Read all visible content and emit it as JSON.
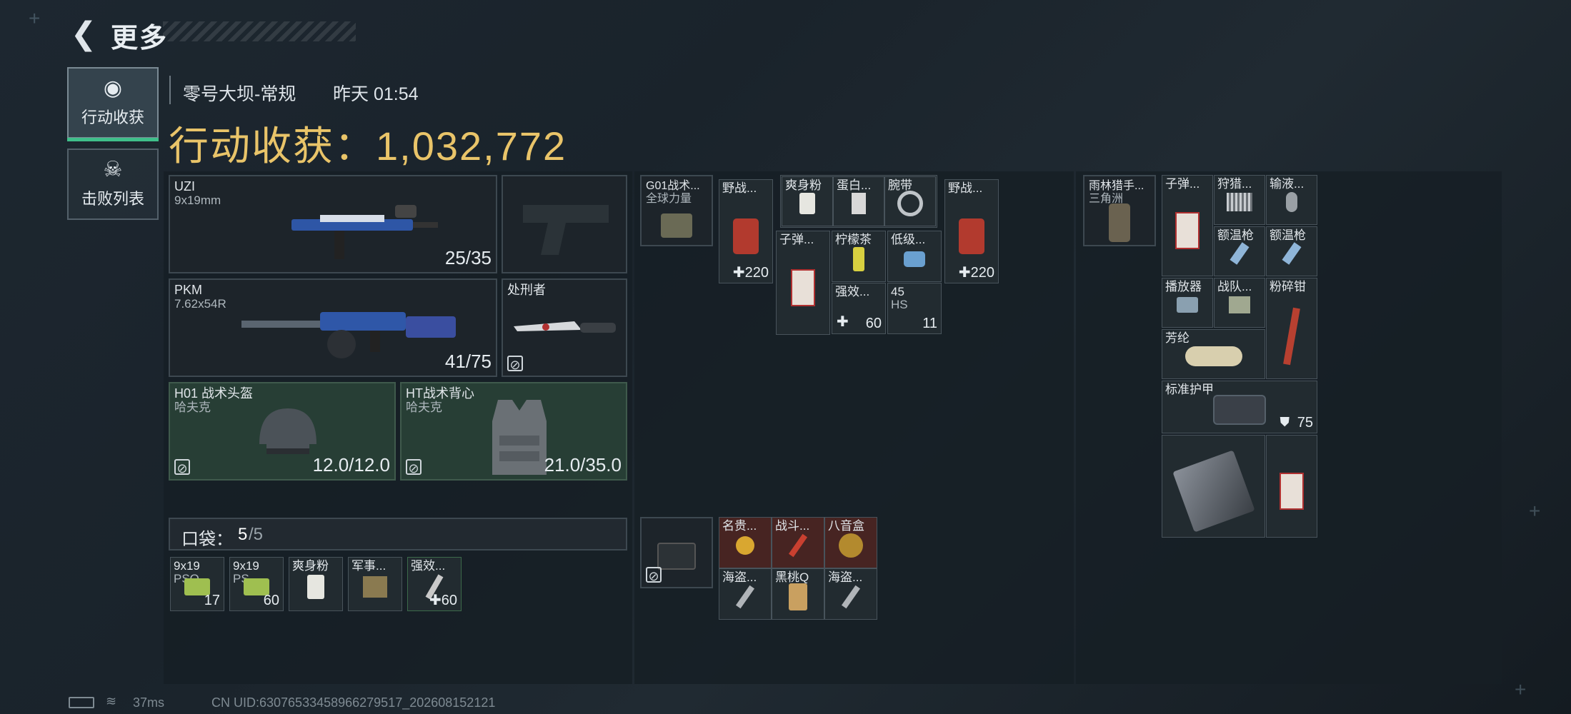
{
  "header": {
    "title": "更多"
  },
  "side_tabs": [
    {
      "label": "行动收获",
      "icon": "loot-coin-icon",
      "active": true
    },
    {
      "label": "击败列表",
      "icon": "skull-icon",
      "active": false
    }
  ],
  "raid": {
    "map": "零号大坝-常规",
    "time": "昨天 01:54"
  },
  "loot_title": "行动收获：1,032,772",
  "loadout": {
    "primary": {
      "name": "UZI",
      "ammo": "9x19mm",
      "count": "25/35"
    },
    "secondary": {
      "name": "PKM",
      "ammo": "7.62x54R",
      "count": "41/75"
    },
    "melee": {
      "name": "处刑者"
    },
    "helmet": {
      "name": "H01 战术头盔",
      "brand": "哈夫克",
      "durability": "12.0/12.0"
    },
    "armor": {
      "name": "HT战术背心",
      "brand": "哈夫克",
      "durability": "21.0/35.0"
    }
  },
  "pocket": {
    "label": "口袋：",
    "count": "5",
    "capacity": "/5",
    "items": [
      {
        "name": "9x19",
        "sub": "PSO",
        "value": "17"
      },
      {
        "name": "9x19",
        "sub": "PS",
        "value": "60"
      },
      {
        "name": "爽身粉",
        "sub": "",
        "value": ""
      },
      {
        "name": "军事...",
        "sub": "",
        "value": ""
      },
      {
        "name": "强效...",
        "sub": "",
        "value": "✚60"
      }
    ]
  },
  "rig": {
    "name": "G01战术...",
    "sub": "全球力量",
    "items": {
      "med1": {
        "name": "野战...",
        "value": "✚220"
      },
      "powder": {
        "name": "爽身粉"
      },
      "protein": {
        "name": "蛋白..."
      },
      "wrist": {
        "name": "腕带"
      },
      "med2": {
        "name": "野战...",
        "value": "✚220"
      },
      "ammo": {
        "name": "子弹..."
      },
      "tea": {
        "name": "柠檬茶"
      },
      "low": {
        "name": "低级..."
      },
      "stim": {
        "name": "强效...",
        "value": "60"
      },
      "hs": {
        "name": "45",
        "sub": "HS",
        "value": "11"
      }
    }
  },
  "case": {
    "items": [
      {
        "name": "名贵..."
      },
      {
        "name": "战斗..."
      },
      {
        "name": "八音盒"
      },
      {
        "name": "海盗..."
      },
      {
        "name": "黑桃Q"
      },
      {
        "name": "海盗..."
      }
    ]
  },
  "backpack": {
    "name": "雨林猎手...",
    "sub": "三角洲",
    "items": {
      "ammo": {
        "name": "子弹..."
      },
      "trap": {
        "name": "狩猎..."
      },
      "infusion": {
        "name": "输液..."
      },
      "gun1": {
        "name": "额温枪"
      },
      "gun2": {
        "name": "额温枪"
      },
      "player": {
        "name": "播放器"
      },
      "squad": {
        "name": "战队..."
      },
      "crusher": {
        "name": "粉碎钳"
      },
      "aroma": {
        "name": "芳纶"
      },
      "armor": {
        "name": "标准护甲",
        "value": "75"
      }
    }
  },
  "footer": {
    "ping": "37ms",
    "uid": "CN UID:63076533458966279517_202608152121"
  }
}
